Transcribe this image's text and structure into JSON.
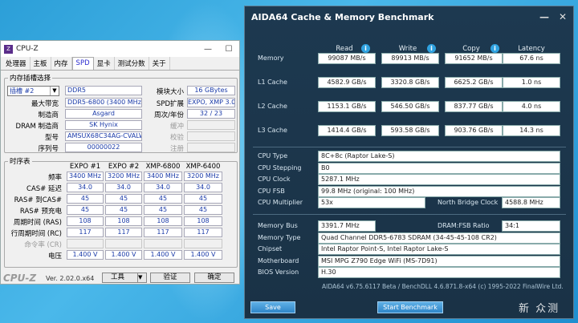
{
  "cpuz": {
    "title": "CPU-Z",
    "tabs": [
      "处理器",
      "主板",
      "内存",
      "SPD",
      "显卡",
      "测试分数",
      "关于"
    ],
    "slot_group": "内存插槽选择",
    "slot_select": "插槽 #2",
    "ddr": "DDR5",
    "labels": {
      "module_size": "模块大小",
      "bandwidth": "最大带宽",
      "spd_ext": "SPD扩展",
      "manufacturer": "制造商",
      "week_year": "周次/年份",
      "dram_mfr": "DRAM 制造商",
      "buffered": "缓冲",
      "model": "型号",
      "correction": "校验",
      "serial": "序列号",
      "registered": "注册"
    },
    "values": {
      "module_size": "16 GBytes",
      "bandwidth": "DDR5-6800 (3400 MHz)",
      "spd_ext": "EXPO, XMP 3.0",
      "manufacturer": "Asgard",
      "week_year": "32 / 23",
      "dram_mfr": "SK Hynix",
      "model": "AMSUX68C34AG-CVALWIN",
      "serial": "00000022"
    },
    "timing_group": "时序表",
    "timing_headers": [
      "EXPO #1",
      "EXPO #2",
      "XMP-6800",
      "XMP-6400"
    ],
    "timing_rows": [
      {
        "label": "频率",
        "vals": [
          "3400 MHz",
          "3200 MHz",
          "3400 MHz",
          "3200 MHz"
        ]
      },
      {
        "label": "CAS# 延迟",
        "vals": [
          "34.0",
          "34.0",
          "34.0",
          "34.0"
        ]
      },
      {
        "label": "RAS# 到CAS#",
        "vals": [
          "45",
          "45",
          "45",
          "45"
        ]
      },
      {
        "label": "RAS# 预充电",
        "vals": [
          "45",
          "45",
          "45",
          "45"
        ]
      },
      {
        "label": "周期时间 (RAS)",
        "vals": [
          "108",
          "108",
          "108",
          "108"
        ]
      },
      {
        "label": "行周期时间 (RC)",
        "vals": [
          "117",
          "117",
          "117",
          "117"
        ]
      },
      {
        "label": "命令率 (CR)",
        "vals": [
          "",
          "",
          "",
          ""
        ]
      },
      {
        "label": "电压",
        "vals": [
          "1.400 V",
          "1.400 V",
          "1.400 V",
          "1.400 V"
        ]
      }
    ],
    "brand": "CPU-Z",
    "version": "Ver. 2.02.0.x64",
    "tools": "工具",
    "validate": "验证",
    "ok": "确定"
  },
  "aida": {
    "title": "AIDA64 Cache & Memory Benchmark",
    "headers": [
      "Read",
      "Write",
      "Copy",
      "Latency"
    ],
    "bench": [
      {
        "label": "Memory",
        "vals": [
          "99087 MB/s",
          "89913 MB/s",
          "91652 MB/s",
          "67.6 ns"
        ]
      },
      {
        "label": "L1 Cache",
        "vals": [
          "4582.9 GB/s",
          "3320.8 GB/s",
          "6625.2 GB/s",
          "1.0 ns"
        ]
      },
      {
        "label": "L2 Cache",
        "vals": [
          "1153.1 GB/s",
          "546.50 GB/s",
          "837.77 GB/s",
          "4.0 ns"
        ]
      },
      {
        "label": "L3 Cache",
        "vals": [
          "1414.4 GB/s",
          "593.58 GB/s",
          "903.76 GB/s",
          "14.3 ns"
        ]
      }
    ],
    "cpu_type_label": "CPU Type",
    "cpu_type": "8C+8c  (Raptor Lake-S)",
    "cpu_stepping_label": "CPU Stepping",
    "cpu_stepping": "B0",
    "cpu_clock_label": "CPU Clock",
    "cpu_clock": "5287.1 MHz",
    "cpu_fsb_label": "CPU FSB",
    "cpu_fsb": "99.8 MHz  (original: 100 MHz)",
    "cpu_mult_label": "CPU Multiplier",
    "cpu_mult": "53x",
    "nb_clock_label": "North Bridge Clock",
    "nb_clock": "4588.8 MHz",
    "mem_bus_label": "Memory Bus",
    "mem_bus": "3391.7 MHz",
    "dram_ratio_label": "DRAM:FSB Ratio",
    "dram_ratio": "34:1",
    "mem_type_label": "Memory Type",
    "mem_type": "Quad Channel DDR5-6783 SDRAM  (34-45-45-108 CR2)",
    "chipset_label": "Chipset",
    "chipset": "Intel Raptor Point-S, Intel Raptor Lake-S",
    "mobo_label": "Motherboard",
    "mobo": "MSI MPG Z790 Edge WiFi (MS-7D91)",
    "bios_label": "BIOS Version",
    "bios": "H.30",
    "copyright": "AIDA64 v6.75.6117 Beta / BenchDLL 4.6.871.8-x64  (c) 1995-2022 FinalWire Ltd.",
    "save": "Save",
    "start": "Start Benchmark"
  },
  "watermark": "新 众测"
}
